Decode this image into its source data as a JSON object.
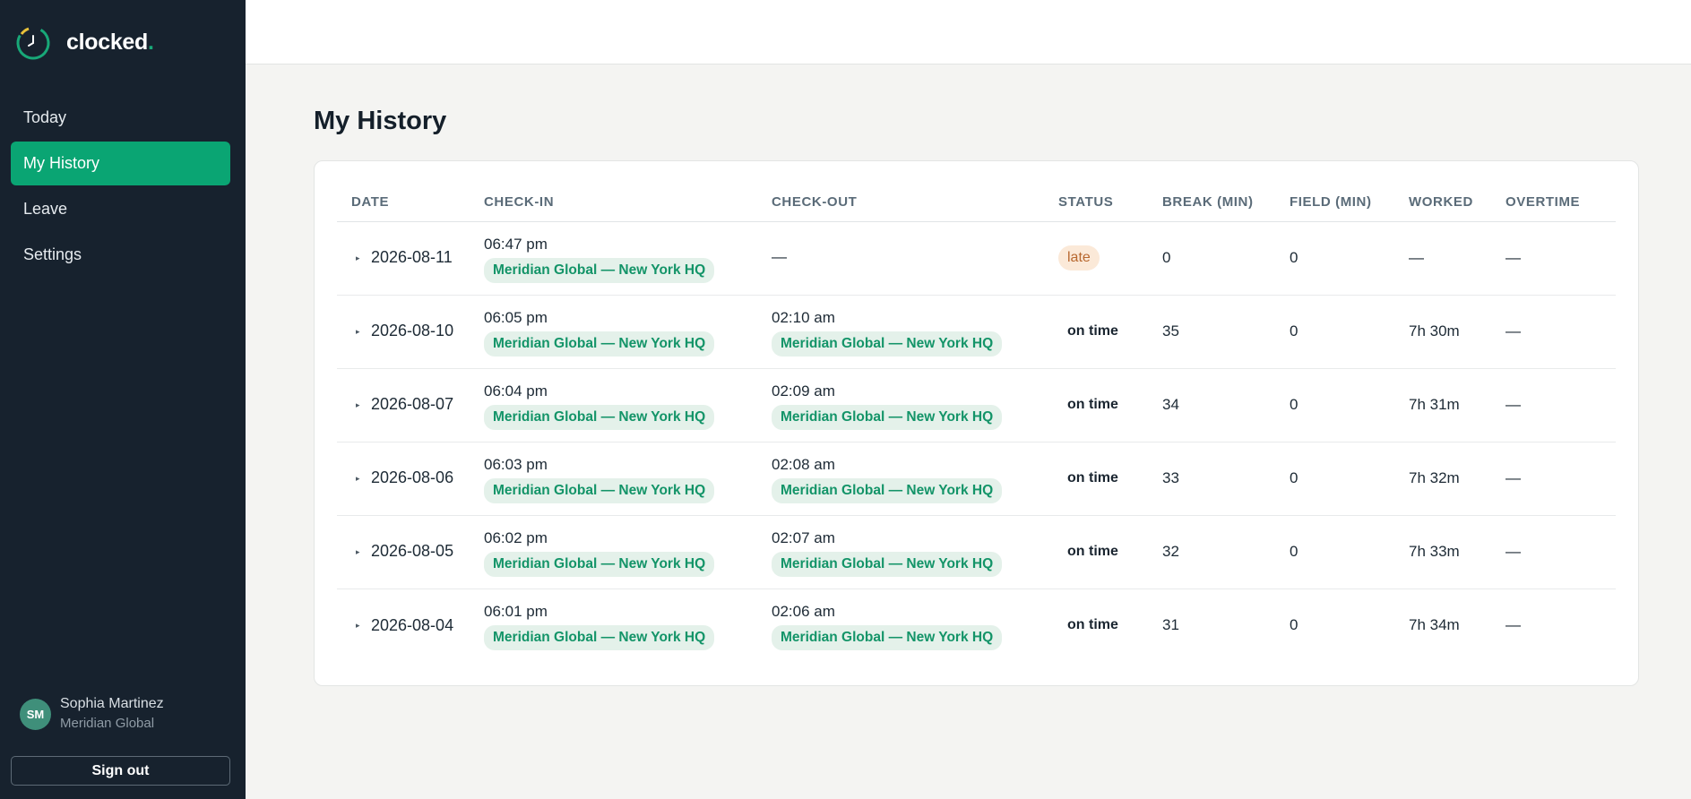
{
  "brand": {
    "name": "clocked",
    "dot": ".",
    "icon": "stopwatch-logo-icon",
    "accent": "#18a878"
  },
  "nav": {
    "items": [
      {
        "label": "Today"
      },
      {
        "label": "My History"
      },
      {
        "label": "Leave"
      },
      {
        "label": "Settings"
      }
    ],
    "active_index": 1
  },
  "user": {
    "initials": "SM",
    "name": "Sophia Martinez",
    "org": "Meridian Global"
  },
  "signout_label": "Sign out",
  "page": {
    "title": "My History"
  },
  "table": {
    "columns": [
      "DATE",
      "CHECK-IN",
      "CHECK-OUT",
      "STATUS",
      "BREAK (MIN)",
      "FIELD (MIN)",
      "WORKED",
      "OVERTIME"
    ],
    "rows": [
      {
        "expander": "▸",
        "date": "2026-08-11",
        "checkin_time": "06:47 pm",
        "checkin_loc": "Meridian Global — New York HQ",
        "checkout_time": "—",
        "checkout_loc": "",
        "status": "late",
        "break": "0",
        "field": "0",
        "worked": "—",
        "overtime": "—"
      },
      {
        "expander": "▸",
        "date": "2026-08-10",
        "checkin_time": "06:05 pm",
        "checkin_loc": "Meridian Global — New York HQ",
        "checkout_time": "02:10 am",
        "checkout_loc": "Meridian Global — New York HQ",
        "status": "on time",
        "break": "35",
        "field": "0",
        "worked": "7h 30m",
        "overtime": "—"
      },
      {
        "expander": "▸",
        "date": "2026-08-07",
        "checkin_time": "06:04 pm",
        "checkin_loc": "Meridian Global — New York HQ",
        "checkout_time": "02:09 am",
        "checkout_loc": "Meridian Global — New York HQ",
        "status": "on time",
        "break": "34",
        "field": "0",
        "worked": "7h 31m",
        "overtime": "—"
      },
      {
        "expander": "▸",
        "date": "2026-08-06",
        "checkin_time": "06:03 pm",
        "checkin_loc": "Meridian Global — New York HQ",
        "checkout_time": "02:08 am",
        "checkout_loc": "Meridian Global — New York HQ",
        "status": "on time",
        "break": "33",
        "field": "0",
        "worked": "7h 32m",
        "overtime": "—"
      },
      {
        "expander": "▸",
        "date": "2026-08-05",
        "checkin_time": "06:02 pm",
        "checkin_loc": "Meridian Global — New York HQ",
        "checkout_time": "02:07 am",
        "checkout_loc": "Meridian Global — New York HQ",
        "status": "on time",
        "break": "32",
        "field": "0",
        "worked": "7h 33m",
        "overtime": "—"
      },
      {
        "expander": "▸",
        "date": "2026-08-04",
        "checkin_time": "06:01 pm",
        "checkin_loc": "Meridian Global — New York HQ",
        "checkout_time": "02:06 am",
        "checkout_loc": "Meridian Global — New York HQ",
        "status": "on time",
        "break": "31",
        "field": "0",
        "worked": "7h 34m",
        "overtime": "—"
      }
    ]
  },
  "colors": {
    "sidebar_bg": "#17222e",
    "active_nav": "#0aa573",
    "location_text": "#139468",
    "late_bg": "#fbe9d8",
    "late_text": "#b8682f"
  }
}
